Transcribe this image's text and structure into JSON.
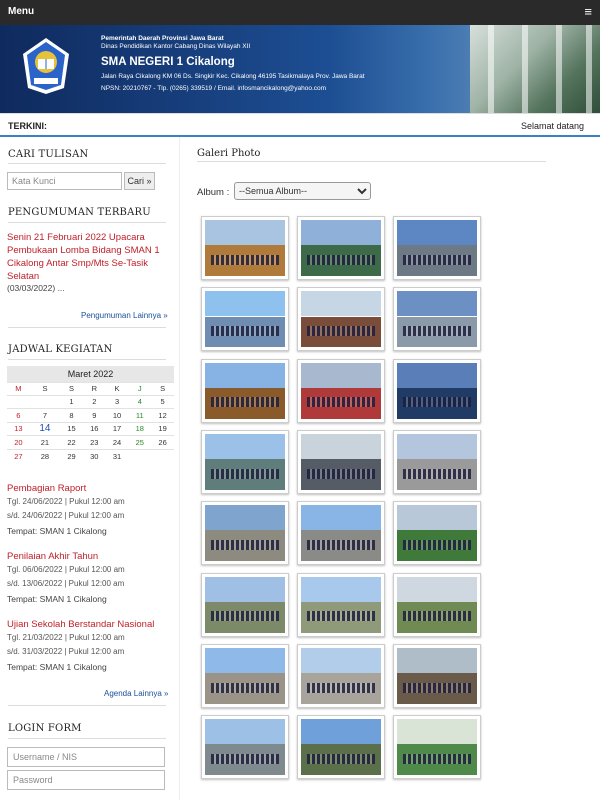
{
  "topbar": {
    "menu_label": "Menu",
    "hamburger": "≡"
  },
  "header": {
    "line1": "Pemerintah Daerah Provinsi Jawa Barat",
    "line2": "Dinas Pendidikan Kantor Cabang Dinas Wilayah XII",
    "school_name": "SMA NEGERI 1 Cikalong",
    "address": "Jalan Raya Cikalong KM 06 Ds. Singkir Kec. Cikalong 46195 Tasikmalaya Prov. Jawa Barat",
    "contact": "NPSN: 20210767 - Tlp. (0265) 339519 / Email. infosmancikalong@yahoo.com",
    "logo_text": "CIKALONG"
  },
  "ticker": {
    "label": "TERKINI:",
    "message": "Selamat datang"
  },
  "search": {
    "title": "CARI TULISAN",
    "placeholder": "Kata Kunci",
    "button": "Cari »"
  },
  "announcements": {
    "title": "PENGUMUMAN TERBARU",
    "item_title": "Senin 21 Februari 2022 Upacara Pembukaan Lomba Bidang SMAN 1 Cikalong Antar Smp/Mts Se-Tasik Selatan",
    "item_meta": "(03/03/2022)   ...",
    "more": "Pengumuman Lainnya »"
  },
  "schedule": {
    "title": "JADWAL KEGIATAN",
    "calendar": {
      "month": "Maret 2022",
      "days": [
        "M",
        "S",
        "S",
        "R",
        "K",
        "J",
        "S"
      ],
      "weeks": [
        [
          "",
          "",
          "1",
          "2",
          "3",
          "4",
          "5"
        ],
        [
          "6",
          "7",
          "8",
          "9",
          "10",
          "11",
          "12"
        ],
        [
          "13",
          "14",
          "15",
          "16",
          "17",
          "18",
          "19"
        ],
        [
          "20",
          "21",
          "22",
          "23",
          "24",
          "25",
          "26"
        ],
        [
          "27",
          "28",
          "29",
          "30",
          "31",
          "",
          ""
        ]
      ],
      "today": "14"
    },
    "events": [
      {
        "title": "Pembagian Raport",
        "start": "Tgl. 24/06/2022 | Pukul 12:00 am",
        "end": "s/d. 24/06/2022 | Pukul 12:00 am",
        "place": "Tempat: SMAN 1 Cikalong"
      },
      {
        "title": "Penilaian Akhir Tahun",
        "start": "Tgl. 06/06/2022 | Pukul 12:00 am",
        "end": "s/d. 13/06/2022 | Pukul 12:00 am",
        "place": "Tempat: SMAN 1 Cikalong"
      },
      {
        "title": "Ujian Sekolah Berstandar Nasional",
        "start": "Tgl. 21/03/2022 | Pukul 12:00 am",
        "end": "s/d. 31/03/2022 | Pukul 12:00 am",
        "place": "Tempat: SMAN 1 Cikalong"
      }
    ],
    "more": "Agenda Lainnya »"
  },
  "login": {
    "title": "LOGIN FORM",
    "username_placeholder": "Username / NIS",
    "password_placeholder": "Password"
  },
  "gallery": {
    "title": "Galeri Photo",
    "album_label": "Album :",
    "album_selected": "--Semua Album--",
    "colors": {
      "sky": [
        "#a9c4e0",
        "#8fb0d8",
        "#5c87c2",
        "#8ec1ee",
        "#c7d6e4",
        "#6c8fc4",
        "#87b2e4",
        "#a7b8cf",
        "#5a7fb8",
        "#9cc1e8",
        "#c9d3dc",
        "#b3c6de",
        "#7fa4cd",
        "#88b4e6",
        "#b8c8d8",
        "#9fbfe5",
        "#a9c9ec",
        "#cfd8e0",
        "#8fb9e9",
        "#b2cde9",
        "#aebdc8",
        "#9cc0e6",
        "#6fa0d9",
        "#d9e3d6"
      ],
      "ground": [
        "#b07a3a",
        "#3d6b4a",
        "#6d7a86",
        "#6e8db0",
        "#7a4d3a",
        "#8a9aa8",
        "#8b5a2a",
        "#b03a3a",
        "#1f3b66",
        "#5f7d7a",
        "#555c66",
        "#9a9a9a",
        "#8d8a80",
        "#8a8a86",
        "#3f7a3a",
        "#7d8a6a",
        "#8f9a7a",
        "#6f8a52",
        "#9a9488",
        "#a8a49c",
        "#6a5a4a",
        "#7f8a8f",
        "#5a6f4a",
        "#4f8a4a"
      ]
    }
  }
}
